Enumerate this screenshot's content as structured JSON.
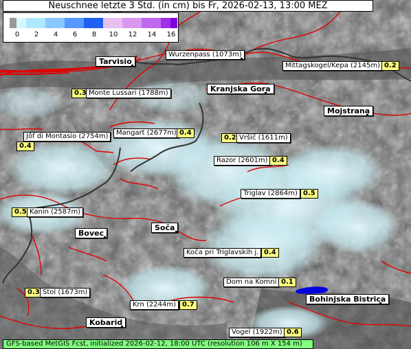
{
  "title": "Neuschnee letzte 3 Std. (in cm) bis Fr, 2026-02-13, 13:00 MEZ",
  "legend": {
    "ticks": [
      "0",
      "2",
      "4",
      "6",
      "8",
      "10",
      "12",
      "14",
      "16"
    ],
    "colors": [
      "#999999",
      "#d8f8ff",
      "#b0e8ff",
      "#88c8ff",
      "#5898ff",
      "#2060f0",
      "#e8c0f0",
      "#d898f0",
      "#c068f0",
      "#a030e8",
      "#8000e0"
    ]
  },
  "footer": "GFS-based MetGIS Fcst, initialized 2026-02-12, 18:00 UTC  (resolution 106 m X 154 m)",
  "towns": [
    {
      "name": "Tarvisio"
    },
    {
      "name": "Kranjska Gora"
    },
    {
      "name": "Mojstrana"
    },
    {
      "name": "Bovec"
    },
    {
      "name": "Soča"
    },
    {
      "name": "Bohinjska Bistrica"
    },
    {
      "name": "Kobarid"
    }
  ],
  "peaks": [
    {
      "name": "Wurzenpass (1073m)",
      "value": ""
    },
    {
      "name": "Mittagskogel/Kepa (2145m)",
      "value": "0.2"
    },
    {
      "name": "Monte Lussari (1788m)",
      "value": "0.3"
    },
    {
      "name": "Jôf di Montasio (2754m)",
      "value": "0.4"
    },
    {
      "name": "Mangart (2677m)",
      "value": "0.4"
    },
    {
      "name": "Vršič (1611m)",
      "value": "0.2"
    },
    {
      "name": "Razor (2601m)",
      "value": "0.4"
    },
    {
      "name": "Triglav (2864m)",
      "value": "0.5"
    },
    {
      "name": "Kanin (2587m)",
      "value": "0.5"
    },
    {
      "name": "Koča pri Triglavskih j.",
      "value": "0.4"
    },
    {
      "name": "Dom na Komni",
      "value": "0.1"
    },
    {
      "name": "Stol (1673m)",
      "value": "0.3"
    },
    {
      "name": "Krn (2244m)",
      "value": "0.7"
    },
    {
      "name": "Vogel (1922m)",
      "value": "0.6"
    }
  ],
  "colors": {
    "snow": "#d8f8ff",
    "border_line": "#e00000",
    "road": "#d81818",
    "river_blue": "#0000e0",
    "value_box": "#ffff80",
    "footer_bg": "#80ff80"
  }
}
